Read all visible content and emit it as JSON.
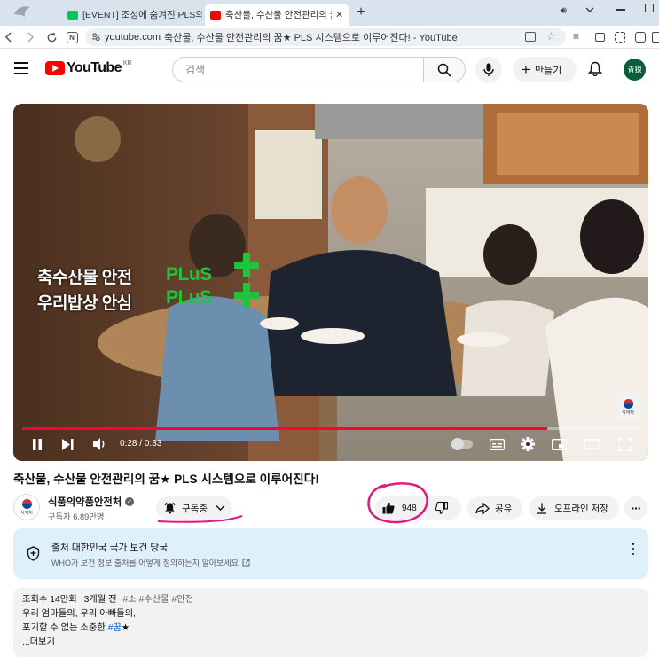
{
  "browser": {
    "tabs": [
      {
        "title": "[EVENT] 조성에 숨겨진 PLS의 비"
      },
      {
        "title": "축산물, 수산물 안전관리의 꿈★"
      }
    ],
    "address_url": "youtube.com",
    "address_page_title": "축산물, 수산물 안전관리의 꿈★ PLS 시스템으로 이루어진다! - YouTube"
  },
  "youtube": {
    "logo_text": "YouTube",
    "region": "KR",
    "search_placeholder": "검색",
    "create_label": "만들기",
    "avatar_text": "青狼"
  },
  "video": {
    "overlay_line1": "축수산물 안전",
    "overlay_line2": "우리밥상 안심",
    "plus_text": "PLuS",
    "watermark_text": "식약처",
    "time_current": "0:28",
    "time_total": "0:33",
    "progress_fraction": 0.85
  },
  "meta": {
    "title": "축산물, 수산물 안전관리의 꿈★ PLS 시스템으로 이루어진다!",
    "channel_name": "식품의약품안전처",
    "channel_logo_text": "식약처",
    "subscribers": "구독자 6.89만명",
    "subscribed_label": "구독중",
    "like_count": "948",
    "share_label": "공유",
    "offline_save_label": "오프라인 저장"
  },
  "info_panel": {
    "title": "출처 대한민국 국가 보건 당국",
    "subtitle": "WHO가 보건 정보 출처를 어떻게 정의하는지 알아보세요"
  },
  "description": {
    "views": "조회수 14만회",
    "date": "3개월 전",
    "tags": "#소 #수산물 #안전",
    "line1": "우리 엄마들의, 우리 아빠들의,",
    "line2": "포기할 수 없는 소중한",
    "line2_tag": "#꿈",
    "line2_star": "★",
    "more": "...더보기"
  },
  "colors": {
    "youtube_red": "#ff0000",
    "progress_red": "#ff0033",
    "plus_green": "#22c33a",
    "annotation_magenta": "#e3197f",
    "avatar_green": "#0b5d3b"
  }
}
